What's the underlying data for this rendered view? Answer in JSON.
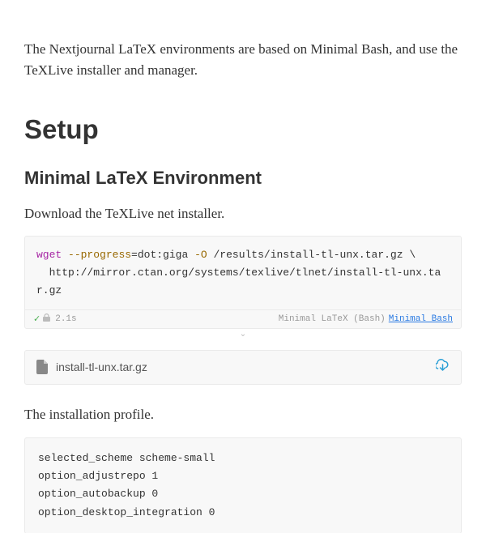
{
  "intro": "The Nextjournal LaTeX environments are based on Minimal Bash, and use the TeXLive installer and manager.",
  "h1": "Setup",
  "h2": "Minimal LaTeX Environment",
  "p1": "Download the TeXLive net installer.",
  "code1": {
    "cmd": "wget",
    "flag1": "--progress",
    "val1": "=dot:giga",
    "flag2": "-O",
    "path": " /results/install-tl-unx.tar.gz \\",
    "line2": "  http://mirror.ctan.org/systems/texlive/tlnet/install-tl-unx.tar.gz"
  },
  "footer": {
    "time": "2.1s",
    "env": "Minimal LaTeX (Bash)",
    "link": "Minimal Bash"
  },
  "file": {
    "name": "install-tl-unx.tar.gz"
  },
  "p2": "The installation profile.",
  "profile": "selected_scheme scheme-small\noption_adjustrepo 1\noption_autobackup 0\noption_desktop_integration 0"
}
